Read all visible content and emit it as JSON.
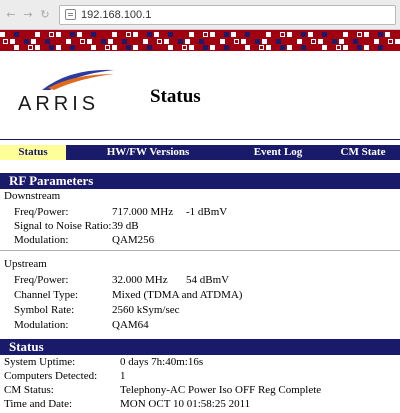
{
  "browser": {
    "url": "192.168.100.1",
    "back_icon": "left-arrow-icon",
    "forward_icon": "right-arrow-icon",
    "reload_icon": "reload-icon",
    "page_icon": "page-icon"
  },
  "logo": {
    "text": "ARRIS"
  },
  "page": {
    "title": "Status"
  },
  "tabs": [
    {
      "label": "Status",
      "active": true
    },
    {
      "label": "HW/FW Versions",
      "active": false
    },
    {
      "label": "Event Log",
      "active": false
    },
    {
      "label": "CM State",
      "active": false
    }
  ],
  "rf": {
    "heading": "RF Parameters",
    "downstream": {
      "heading": "Downstream",
      "freq_label": "Freq/Power:",
      "freq": "717.000 MHz",
      "power": "-1 dBmV",
      "snr_label": "Signal to Noise Ratio:",
      "snr": "39 dB",
      "mod_label": "Modulation:",
      "mod": "QAM256"
    },
    "upstream": {
      "heading": "Upstream",
      "freq_label": "Freq/Power:",
      "freq": "32.000 MHz",
      "power": "54 dBmV",
      "channel_label": "Channel Type:",
      "channel": "Mixed (TDMA and ATDMA)",
      "symbol_label": "Symbol Rate:",
      "symbol": "2560 kSym/sec",
      "mod_label": "Modulation:",
      "mod": "QAM64"
    }
  },
  "status": {
    "heading": "Status",
    "uptime_label": "System Uptime:",
    "uptime": "0 days 7h:40m:16s",
    "computers_label": "Computers Detected:",
    "computers": "1",
    "cm_label": "CM Status:",
    "cm": "Telephony-AC Power Iso OFF Reg Complete",
    "time_label": "Time and Date:",
    "time": "MON OCT 10 01:58:25 2011"
  },
  "colors": {
    "navy": "#1a1a6a",
    "banner_red": "#a00010",
    "active_tab": "#ffff99"
  }
}
